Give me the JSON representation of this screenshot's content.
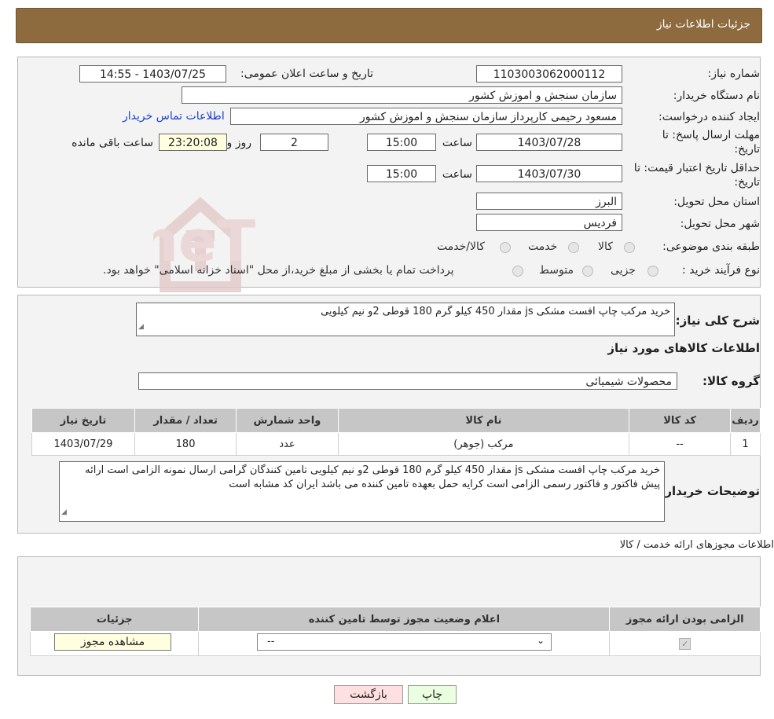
{
  "header": {
    "title": "جزئیات اطلاعات نیاز"
  },
  "form": {
    "need_number_label": "شماره نیاز:",
    "need_number": "1103003062000112",
    "announce_label": "تاریخ و ساعت اعلان عمومی:",
    "announce_value": "1403/07/25 - 14:55",
    "buyer_org_label": "نام دستگاه خریدار:",
    "buyer_org": "سازمان سنجش و اموزش کشور",
    "requester_label": "ایجاد کننده درخواست:",
    "requester": "مسعود رحیمی کارپرداز سازمان سنجش و اموزش کشور",
    "contact_link": "اطلاعات تماس خریدار",
    "deadline_label_1": "مهلت ارسال پاسخ: تا",
    "deadline_label_2": "تاریخ:",
    "deadline_date": "1403/07/28",
    "time_label": "ساعت",
    "deadline_time": "15:00",
    "days_value": "2",
    "days_label": "روز و",
    "remaining_time": "23:20:08",
    "remaining_label": "ساعت باقی مانده",
    "validity_label_1": "حداقل تاریخ اعتبار قیمت: تا",
    "validity_label_2": "تاریخ:",
    "validity_date": "1403/07/30",
    "validity_time": "15:00",
    "province_label": "استان محل تحویل:",
    "province": "البرز",
    "city_label": "شهر محل تحویل:",
    "city": "فردیس",
    "category_label": "طبقه بندی موضوعی:",
    "category_options": [
      "کالا",
      "خدمت",
      "کالا/خدمت"
    ],
    "process_label": "نوع فرآیند خرید :",
    "process_options": [
      "جزیی",
      "متوسط"
    ],
    "process_note": "پرداخت تمام یا بخشی از مبلغ خرید،از محل \"اسناد خزانه اسلامی\" خواهد بود."
  },
  "summary": {
    "desc_label": "شرح کلی نیاز:",
    "desc_value": "خرید مرکب چاپ افست مشکی js مقدار 450 کیلو گرم  180 قوطی 2و نیم کیلویی",
    "goods_info_title": "اطلاعات کالاهای مورد نیاز",
    "group_label": "گروه کالا:",
    "group_value": "محصولات شیمیائی",
    "table": {
      "headers": [
        "ردیف",
        "کد کالا",
        "نام کالا",
        "واحد شمارش",
        "تعداد / مقدار",
        "تاریخ نیاز"
      ],
      "rows": [
        [
          "1",
          "--",
          "مرکب (جوهر)",
          "عدد",
          "180",
          "1403/07/29"
        ]
      ]
    },
    "buyer_notes_label": "توضیحات خریدار:",
    "buyer_notes": "خرید مرکب چاپ افست مشکی js مقدار 450 کیلو گرم  180 قوطی 2و نیم کیلویی تامین کنندگان گرامی ارسال نمونه الزامی است ارائه پیش فاکتور و فاکتور رسمی  الزامی است کرایه حمل بعهده تامین کننده می باشد ایران کد مشابه است"
  },
  "permits": {
    "title": "اطلاعات مجوزهای ارائه خدمت / کالا",
    "headers": [
      "الزامی بودن ارائه مجوز",
      "اعلام وضعیت مجوز توسط تامین کننده",
      "جزئیات"
    ],
    "select_value": "--",
    "view_button": "مشاهده مجوز"
  },
  "footer": {
    "print_button": "چاپ",
    "back_button": "بازگشت"
  },
  "watermark": {
    "text": "AriaTender.neT"
  },
  "colors": {
    "header_bg": "#8d6b3f",
    "link": "#1a3fd0",
    "print_bg": "#e9ffe0",
    "back_bg": "#ffe0e0"
  }
}
